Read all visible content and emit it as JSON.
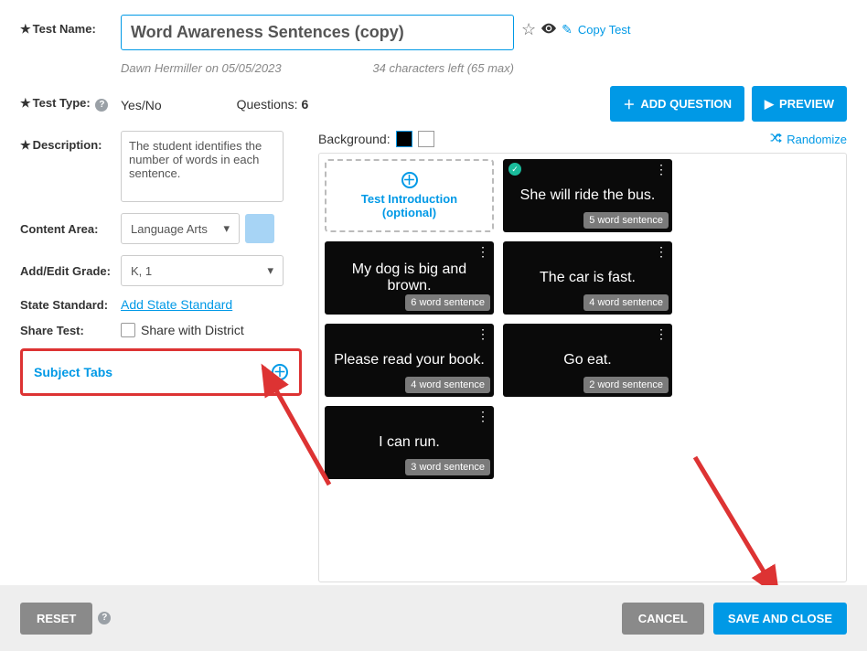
{
  "labels": {
    "test_name": "Test Name:",
    "test_type": "Test Type:",
    "description": "Description:",
    "content_area": "Content Area:",
    "add_edit_grade": "Add/Edit Grade:",
    "state_standard": "State Standard:",
    "share_test": "Share Test:",
    "subject_tabs": "Subject Tabs",
    "questions": "Questions:",
    "background": "Background:",
    "share_with_district": "Share with District"
  },
  "test_name_value": "Word Awareness Sentences (copy)",
  "author_line": "Dawn Hermiller on 05/05/2023",
  "chars_left": "34 characters left (65 max)",
  "copy_test": "Copy Test",
  "test_type_value": "Yes/No",
  "questions_count": "6",
  "buttons": {
    "add_question": "ADD QUESTION",
    "preview": "PREVIEW",
    "reset": "RESET",
    "cancel": "CANCEL",
    "save_close": "SAVE AND CLOSE"
  },
  "description_value": "The student identifies the number of words in each sentence.",
  "content_area_value": "Language Arts",
  "grade_value": "K, 1",
  "add_state_standard": "Add State Standard",
  "randomize": "Randomize",
  "intro_card": {
    "line1": "Test Introduction",
    "line2": "(optional)"
  },
  "cards": [
    {
      "text": "She will ride the bus.",
      "badge": "5 word sentence",
      "check": true
    },
    {
      "text": "My dog is big and brown.",
      "badge": "6 word sentence",
      "check": false
    },
    {
      "text": "The car is fast.",
      "badge": "4 word sentence",
      "check": false
    },
    {
      "text": "Please read your book.",
      "badge": "4 word sentence",
      "check": false
    },
    {
      "text": "Go eat.",
      "badge": "2 word sentence",
      "check": false
    },
    {
      "text": "I can run.",
      "badge": "3 word sentence",
      "check": false
    }
  ],
  "colors": {
    "accent": "#0099e6",
    "annotation": "#d33"
  }
}
